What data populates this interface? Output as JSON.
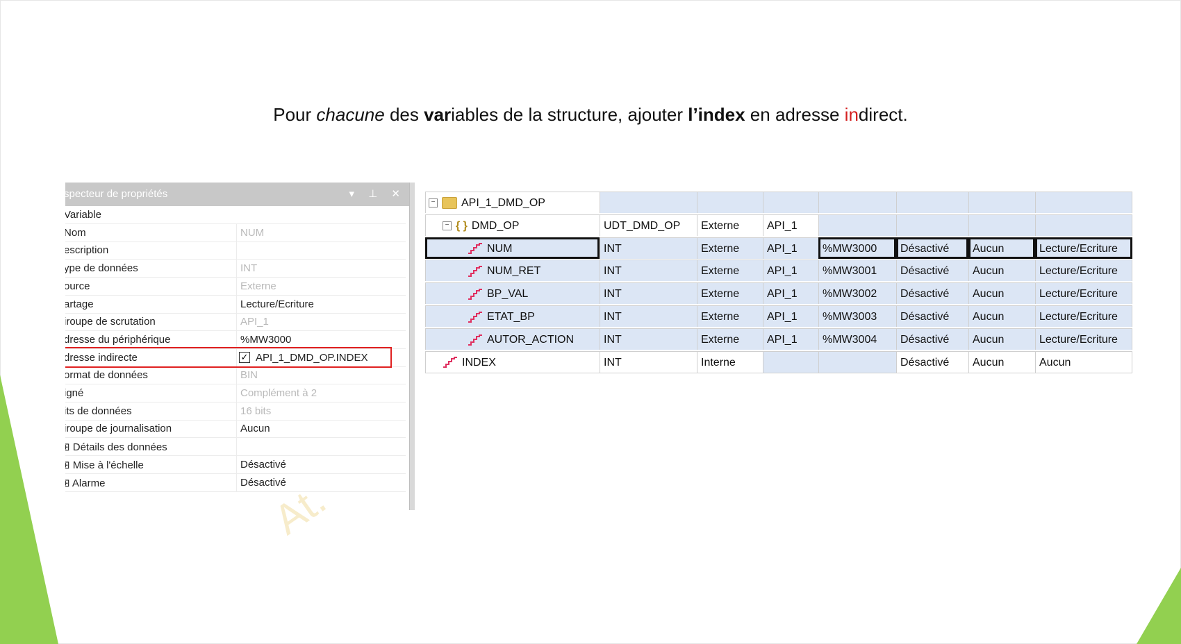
{
  "slide": {
    "title_parts": [
      "Pour ",
      "chacune",
      " des ",
      "var",
      "iables de la structure, ajouter ",
      "l’index",
      " en adresse ",
      "in",
      "direct."
    ]
  },
  "inspector": {
    "title": "Inspecteur de propriétés",
    "title_visible": "specteur de propriétés",
    "buttons": "▾ ⊥ ✕",
    "rows": [
      {
        "key": "Variable",
        "value": "",
        "dim": false
      },
      {
        "key": "Nom",
        "value": "NUM",
        "dim": true
      },
      {
        "key": "Description",
        "value": "",
        "dim": false
      },
      {
        "key": "Type de données",
        "value": "INT",
        "dim": true
      },
      {
        "key": "Source",
        "value": "Externe",
        "dim": true
      },
      {
        "key": "Partage",
        "value": "Lecture/Ecriture",
        "dim": false
      },
      {
        "key": "Groupe de scrutation",
        "value": "API_1",
        "dim": true
      },
      {
        "key": "Adresse du périphérique",
        "value": "%MW3000",
        "dim": false
      },
      {
        "key": "Adresse indirecte",
        "value": "API_1_DMD_OP.INDEX",
        "dim": false,
        "checkbox": true
      },
      {
        "key": "Format de données",
        "value": "BIN",
        "dim": true
      },
      {
        "key": "Signé",
        "value": "Complément à 2",
        "dim": true
      },
      {
        "key": "Bits de données",
        "value": "16 bits",
        "dim": true
      },
      {
        "key": "Groupe de journalisation",
        "value": "Aucun",
        "dim": false
      },
      {
        "key": "Détails des données",
        "value": "",
        "dim": false
      },
      {
        "key": "Mise à l'échelle",
        "value": "Désactivé",
        "dim": false
      },
      {
        "key": "Alarme",
        "value": "Désactivé",
        "dim": false
      }
    ],
    "visible_keys": [
      "Variable",
      "Nom",
      "escription",
      "ype de données",
      "ource",
      "artage",
      "iroupe de scrutation",
      "dresse du périphérique",
      "dresse indirecte",
      "ormat de données",
      "igné",
      "its de données",
      "iroupe de journalisation",
      "Détails des données",
      "Mise à l'échelle",
      "Alarme"
    ],
    "watermark": "At."
  },
  "table": {
    "rows": [
      {
        "name": "API_1_DMD_OP",
        "type": "",
        "source": "",
        "group": "",
        "address": "",
        "scaling": "",
        "log": "",
        "share": "",
        "level": 0,
        "icon": "folder",
        "toggle": "⊟"
      },
      {
        "name": "DMD_OP",
        "type": "UDT_DMD_OP",
        "source": "Externe",
        "group": "API_1",
        "address": "",
        "scaling": "",
        "log": "",
        "share": "",
        "level": 1,
        "icon": "struct",
        "toggle": "⊟"
      },
      {
        "name": "NUM",
        "type": "INT",
        "source": "Externe",
        "group": "API_1",
        "address": "%MW3000",
        "scaling": "Désactivé",
        "log": "Aucun",
        "share": "Lecture/Ecriture",
        "level": 2,
        "icon": "var",
        "selected": true
      },
      {
        "name": "NUM_RET",
        "type": "INT",
        "source": "Externe",
        "group": "API_1",
        "address": "%MW3001",
        "scaling": "Désactivé",
        "log": "Aucun",
        "share": "Lecture/Ecriture",
        "level": 2,
        "icon": "var"
      },
      {
        "name": "BP_VAL",
        "type": "INT",
        "source": "Externe",
        "group": "API_1",
        "address": "%MW3002",
        "scaling": "Désactivé",
        "log": "Aucun",
        "share": "Lecture/Ecriture",
        "level": 2,
        "icon": "var"
      },
      {
        "name": "ETAT_BP",
        "type": "INT",
        "source": "Externe",
        "group": "API_1",
        "address": "%MW3003",
        "scaling": "Désactivé",
        "log": "Aucun",
        "share": "Lecture/Ecriture",
        "level": 2,
        "icon": "var"
      },
      {
        "name": "AUTOR_ACTION",
        "type": "INT",
        "source": "Externe",
        "group": "API_1",
        "address": "%MW3004",
        "scaling": "Désactivé",
        "log": "Aucun",
        "share": "Lecture/Ecriture",
        "level": 2,
        "icon": "var"
      },
      {
        "name": "INDEX",
        "type": "INT",
        "source": "Interne",
        "group": "",
        "address": "",
        "scaling": "Désactivé",
        "log": "Aucun",
        "share": "Aucun",
        "level": 1,
        "icon": "var"
      }
    ]
  },
  "colors": {
    "accent_green": "#92d050",
    "red_box": "#e02020",
    "row_blue": "#dce6f5"
  }
}
